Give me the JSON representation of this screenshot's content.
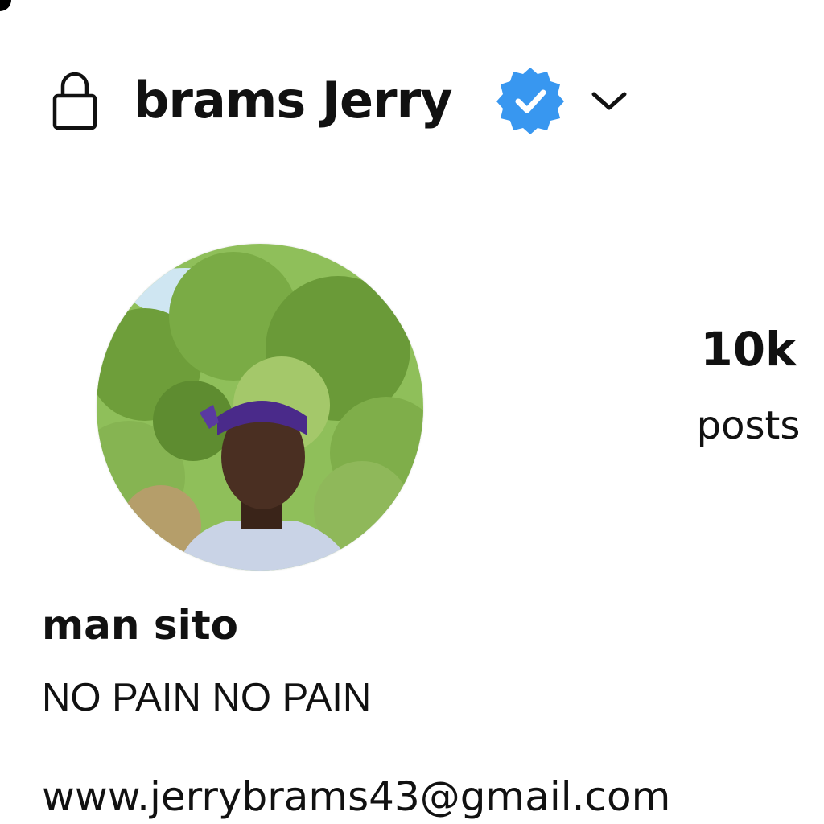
{
  "profile": {
    "username": "brams Jerry",
    "display_name": "man sito",
    "bio": "NO PAIN NO PAIN",
    "link": "www.jerrybrams43@gmail.com"
  },
  "stats": [
    {
      "count": "10k",
      "label": "posts"
    }
  ],
  "icons": {
    "lock": "lock-icon",
    "verified": "verified-badge-icon",
    "chevron": "chevron-down-icon"
  },
  "colors": {
    "verified_badge": "#3897f0",
    "text": "#111111",
    "background": "#ffffff"
  }
}
